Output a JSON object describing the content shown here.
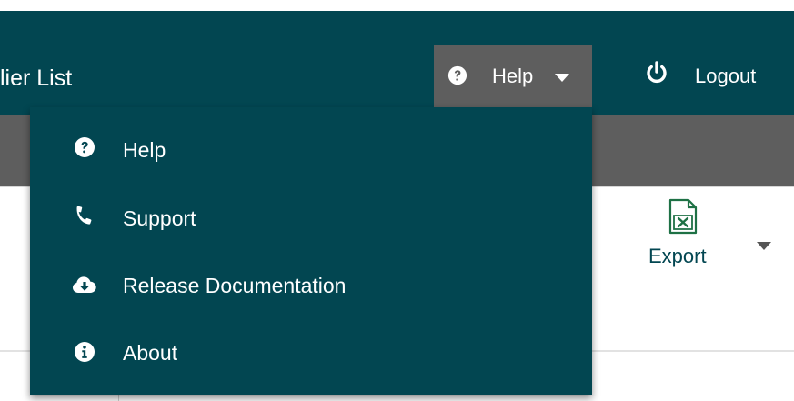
{
  "header": {
    "title": "lier List",
    "help_label": "Help",
    "logout_label": "Logout"
  },
  "toolbar": {
    "export_label": "Export"
  },
  "help_menu": {
    "items": [
      {
        "label": "Help",
        "icon": "question-circle-icon"
      },
      {
        "label": "Support",
        "icon": "phone-icon"
      },
      {
        "label": "Release Documentation",
        "icon": "cloud-download-icon"
      },
      {
        "label": "About",
        "icon": "info-circle-icon"
      }
    ]
  },
  "colors": {
    "navbar": "#024651",
    "help_toggle_active": "#5e5e5e",
    "dropdown": "#024651",
    "export_text": "#024651",
    "excel_icon": "#1e7145"
  }
}
